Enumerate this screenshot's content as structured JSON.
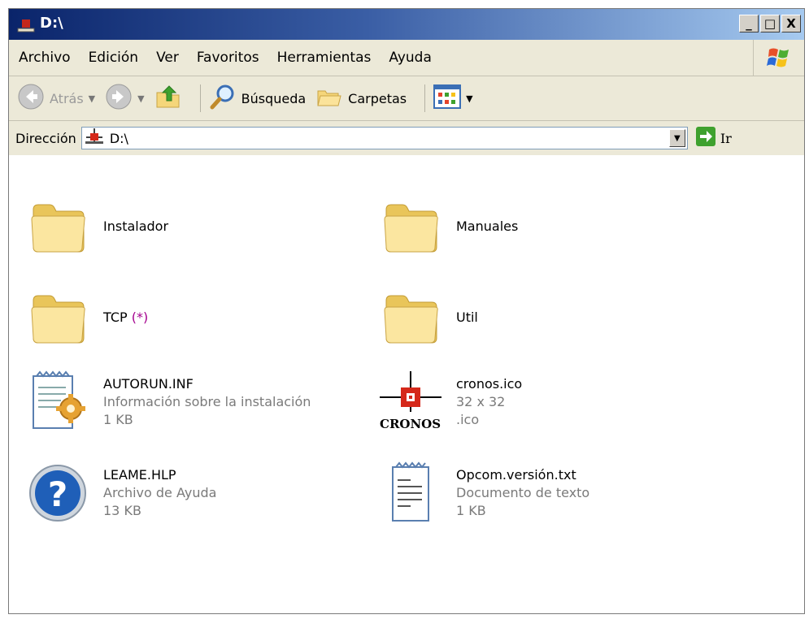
{
  "window": {
    "title": "D:\\"
  },
  "title_buttons": {
    "minimize": "_",
    "maximize": "□",
    "close": "X"
  },
  "menu": [
    {
      "label": "Archivo"
    },
    {
      "label": "Edición"
    },
    {
      "label": "Ver"
    },
    {
      "label": "Favoritos"
    },
    {
      "label": "Herramientas"
    },
    {
      "label": "Ayuda"
    }
  ],
  "toolbar": {
    "back_label": "Atrás",
    "search_label": "Búsqueda",
    "folders_label": "Carpetas"
  },
  "address": {
    "label": "Dirección",
    "path": "D:\\",
    "go_label": "Ir"
  },
  "items": [
    {
      "name": "Instalador",
      "type": "folder"
    },
    {
      "name": "Manuales",
      "type": "folder"
    },
    {
      "name": "TCP",
      "suffix": "(*)",
      "type": "folder"
    },
    {
      "name": "Util",
      "type": "folder"
    },
    {
      "name": "AUTORUN.INF",
      "line2": "Información sobre la instalación",
      "line3": "1 KB",
      "type": "inf"
    },
    {
      "name": "cronos.ico",
      "line2": "32 x 32",
      "line3": ".ico",
      "type": "ico",
      "icon_text": "CRONOS"
    },
    {
      "name": "LEAME.HLP",
      "line2": "Archivo de Ayuda",
      "line3": "13 KB",
      "type": "hlp"
    },
    {
      "name": "Opcom.versión.txt",
      "line2": "Documento de texto",
      "line3": "1 KB",
      "type": "txt"
    }
  ]
}
